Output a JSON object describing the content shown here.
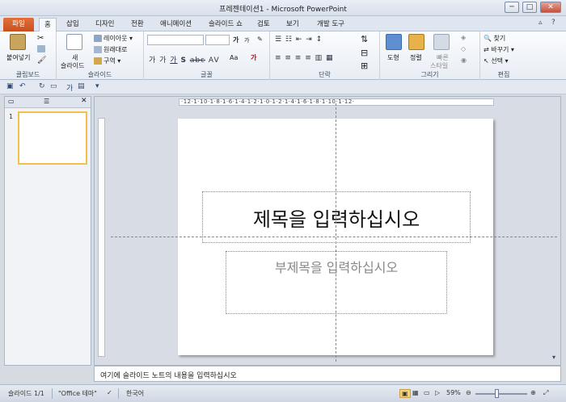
{
  "window": {
    "title": "프레젠테이션1 - Microsoft PowerPoint",
    "min": "─",
    "max": "□",
    "close": "✕"
  },
  "tabs": [
    "파일",
    "홈",
    "삽입",
    "디자인",
    "전환",
    "애니메이션",
    "슬라이드 쇼",
    "검토",
    "보기",
    "개발 도구"
  ],
  "ribbon": {
    "clipboard": {
      "paste": "붙여넣기",
      "label": "클립보드"
    },
    "slides": {
      "new_slide": "새\n슬라이드",
      "new_slide_line1": "새",
      "new_slide_line2": "슬라이드",
      "layout": "레이아웃",
      "reset": "원래대로",
      "section": "구역",
      "label": "슬라이드"
    },
    "font": {
      "grow": "가",
      "shrink": "가",
      "case": "Aa",
      "label": "글꼴"
    },
    "paragraph": {
      "label": "단락"
    },
    "drawing": {
      "shapes": "도형",
      "arrange": "정렬",
      "quick_styles": "빠른\n스타일",
      "quick_styles_line1": "빠른",
      "quick_styles_line2": "스타일",
      "label": "그리기"
    },
    "editing": {
      "find": "찾기",
      "replace": "바꾸기",
      "select": "선택",
      "label": "편집"
    }
  },
  "slides_pane": {
    "slide_number": "1"
  },
  "ruler": {
    "h_labels": "·12·1·10·1·8·1·6·1·4·1·2·1·0·1·2·1·4·1·6·1·8·1·10·1·12·"
  },
  "slide": {
    "title_placeholder": "제목을 입력하십시오",
    "subtitle_placeholder": "부제목을 입력하십시오"
  },
  "notes": {
    "placeholder": "여기에 슬라이드 노트의 내용을 입력하십시오"
  },
  "status": {
    "slide_count": "슬라이드 1/1",
    "theme": "\"Office 테마\"",
    "language": "한국어",
    "zoom": "59%"
  }
}
